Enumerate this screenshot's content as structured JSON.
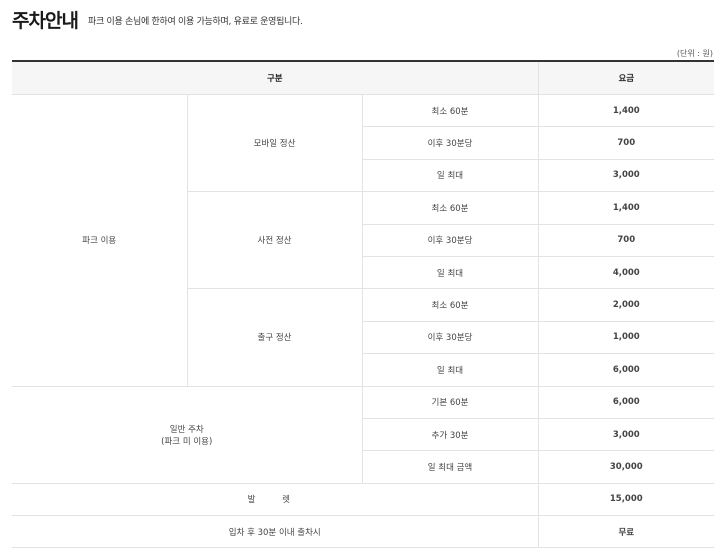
{
  "header": {
    "title": "주차안내",
    "subtitle": "파크 이용 손님에 한하여 이용 가능하며, 유료로 운영됩니다."
  },
  "unit_note": "(단위 : 원)",
  "table": {
    "headers": [
      "구분",
      "요금"
    ],
    "groups": {
      "park": "파크 이용",
      "mobile": "모바일 정산",
      "pre": "사전 정산",
      "exit": "출구 정산",
      "general": "일반 주차",
      "general_sub": "(파크 미 이용)",
      "valet": "발 렛",
      "free_exit": "입차 후 30분 이내 출차시"
    },
    "rows": [
      {
        "item": "최소 60분",
        "price": "1,400"
      },
      {
        "item": "이후 30분당",
        "price": "700"
      },
      {
        "item": "일 최대",
        "price": "3,000"
      },
      {
        "item": "최소 60분",
        "price": "1,400"
      },
      {
        "item": "이후 30분당",
        "price": "700"
      },
      {
        "item": "일 최대",
        "price": "4,000"
      },
      {
        "item": "최소 60분",
        "price": "2,000"
      },
      {
        "item": "이후 30분당",
        "price": "1,000"
      },
      {
        "item": "일 최대",
        "price": "6,000"
      },
      {
        "item": "기본 60분",
        "price": "6,000"
      },
      {
        "item": "추가 30분",
        "price": "3,000"
      },
      {
        "item": "일 최대 금액",
        "price": "30,000"
      }
    ],
    "valet_price": "15,000",
    "free_exit_price": "무료"
  },
  "colors": {
    "price_text": "#2a6b2a",
    "header_bg": "#f6f6f6",
    "border": "#e3e3e3"
  }
}
